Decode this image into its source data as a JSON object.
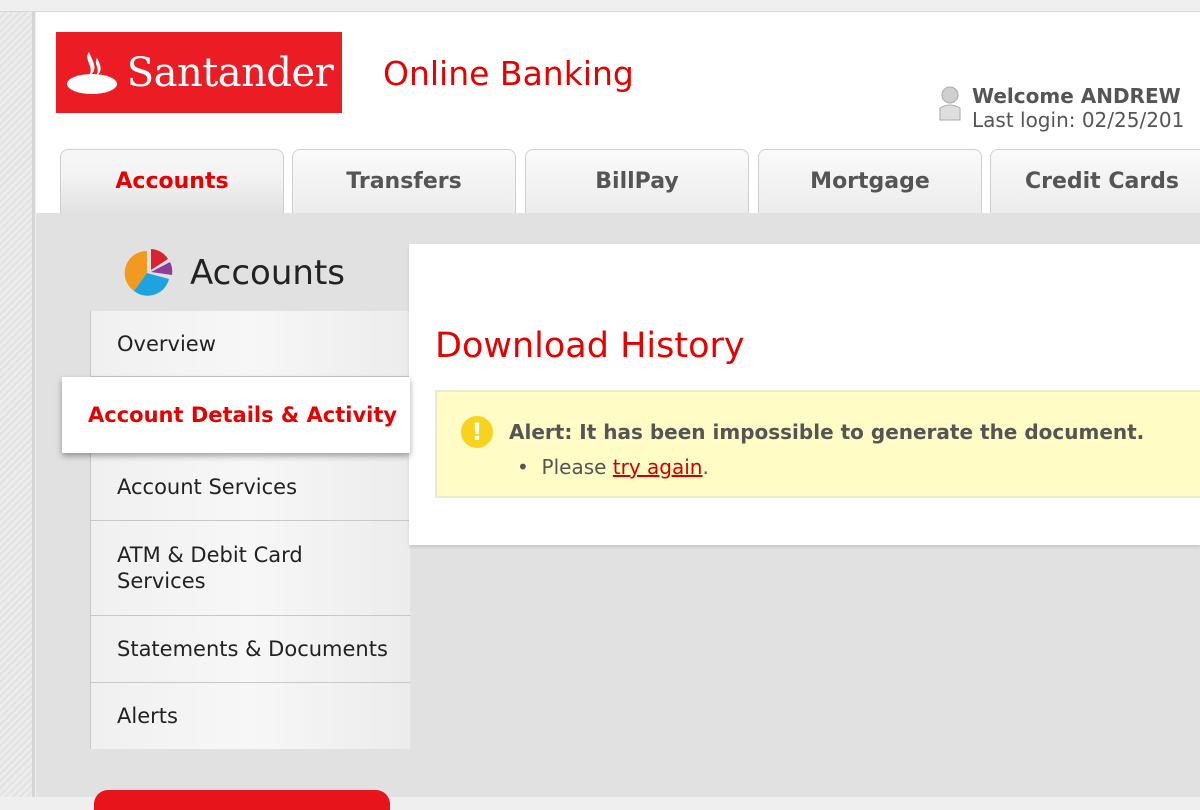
{
  "brand": {
    "logo_text": "Santander",
    "app_title": "Online Banking",
    "brand_color": "#ec1c24",
    "accent_color": "#e60000"
  },
  "user": {
    "welcome": "Welcome ANDREW",
    "last_login": "Last login: 02/25/201",
    "icon": "user-icon"
  },
  "tabs": [
    {
      "label": "Accounts",
      "active": true
    },
    {
      "label": "Transfers",
      "active": false
    },
    {
      "label": "BillPay",
      "active": false
    },
    {
      "label": "Mortgage",
      "active": false
    },
    {
      "label": "Credit Cards",
      "active": false
    }
  ],
  "sidebar": {
    "title": "Accounts",
    "icon": "pie-chart-icon",
    "items": [
      {
        "label": "Overview"
      },
      {
        "label": "Account Details & Activity",
        "active": true
      },
      {
        "label": "Account Services"
      },
      {
        "label": "ATM & Debit Card Services"
      },
      {
        "label": "Statements & Documents"
      },
      {
        "label": "Alerts"
      }
    ]
  },
  "main": {
    "title": "Download History",
    "alert": {
      "icon": "exclamation-icon",
      "message": "Alert: It has been impossible to generate the document.",
      "sub_prefix": "Please ",
      "link_text": "try again",
      "sub_suffix": "."
    }
  }
}
